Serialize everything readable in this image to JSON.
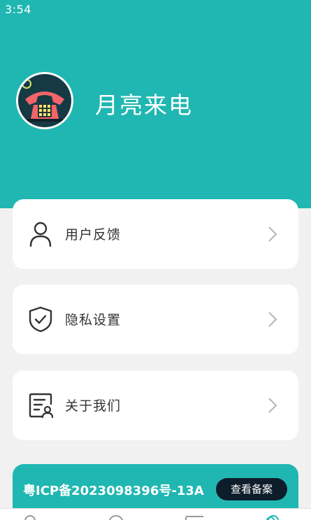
{
  "status_bar": {
    "time": "3:54"
  },
  "profile": {
    "app_name": "月亮来电"
  },
  "menu": {
    "items": [
      {
        "label": "用户反馈",
        "icon": "user-icon"
      },
      {
        "label": "隐私设置",
        "icon": "shield-check-icon"
      },
      {
        "label": "关于我们",
        "icon": "about-doc-icon"
      }
    ]
  },
  "icp": {
    "text": "粤ICP备2023098396号-13A",
    "button_label": "查看备案"
  },
  "colors": {
    "accent": "#20b7b2",
    "background": "#f1f1f1",
    "card": "#ffffff",
    "button_dark": "#0e1d2b"
  },
  "tabbar": {
    "tabs": [
      {
        "icon": "home-icon"
      },
      {
        "icon": "discover-icon"
      },
      {
        "icon": "message-icon"
      },
      {
        "icon": "profile-icon"
      }
    ]
  }
}
